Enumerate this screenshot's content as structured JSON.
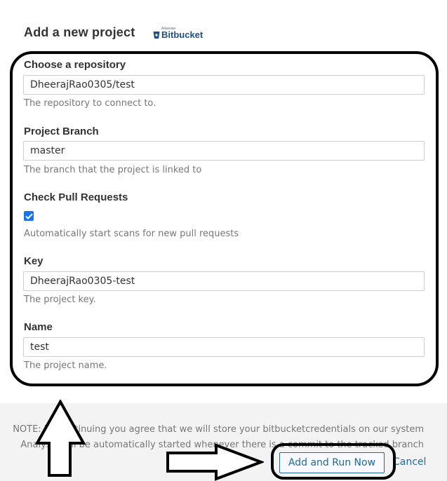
{
  "page": {
    "title": "Add a new project",
    "logo_small": "Atlassian",
    "logo_brand": "Bitbucket"
  },
  "form": {
    "repository": {
      "label": "Choose a repository",
      "value": "DheerajRao0305/test",
      "help": "The repository to connect to."
    },
    "branch": {
      "label": "Project Branch",
      "value": "master",
      "help": "The branch that the project is linked to"
    },
    "pull_requests": {
      "label": "Check Pull Requests",
      "checked": true,
      "help": "Automatically start scans for new pull requests"
    },
    "key": {
      "label": "Key",
      "value": "DheerajRao0305-test",
      "help": "The project key."
    },
    "name": {
      "label": "Name",
      "value": "test",
      "help": "The project name."
    }
  },
  "footer": {
    "notice_line1": "NOTE: by continuing you agree that we will store your bitbucketcredentials on our system",
    "notice_line2": "Analysis will be automatically started whenever there is a commit to the tracked branch",
    "run_button": "Add and Run Now",
    "cancel": "Cancel"
  },
  "colors": {
    "accent": "#236a97",
    "checkbox": "#1a73e8",
    "footer_bg": "#f3f3f3"
  }
}
